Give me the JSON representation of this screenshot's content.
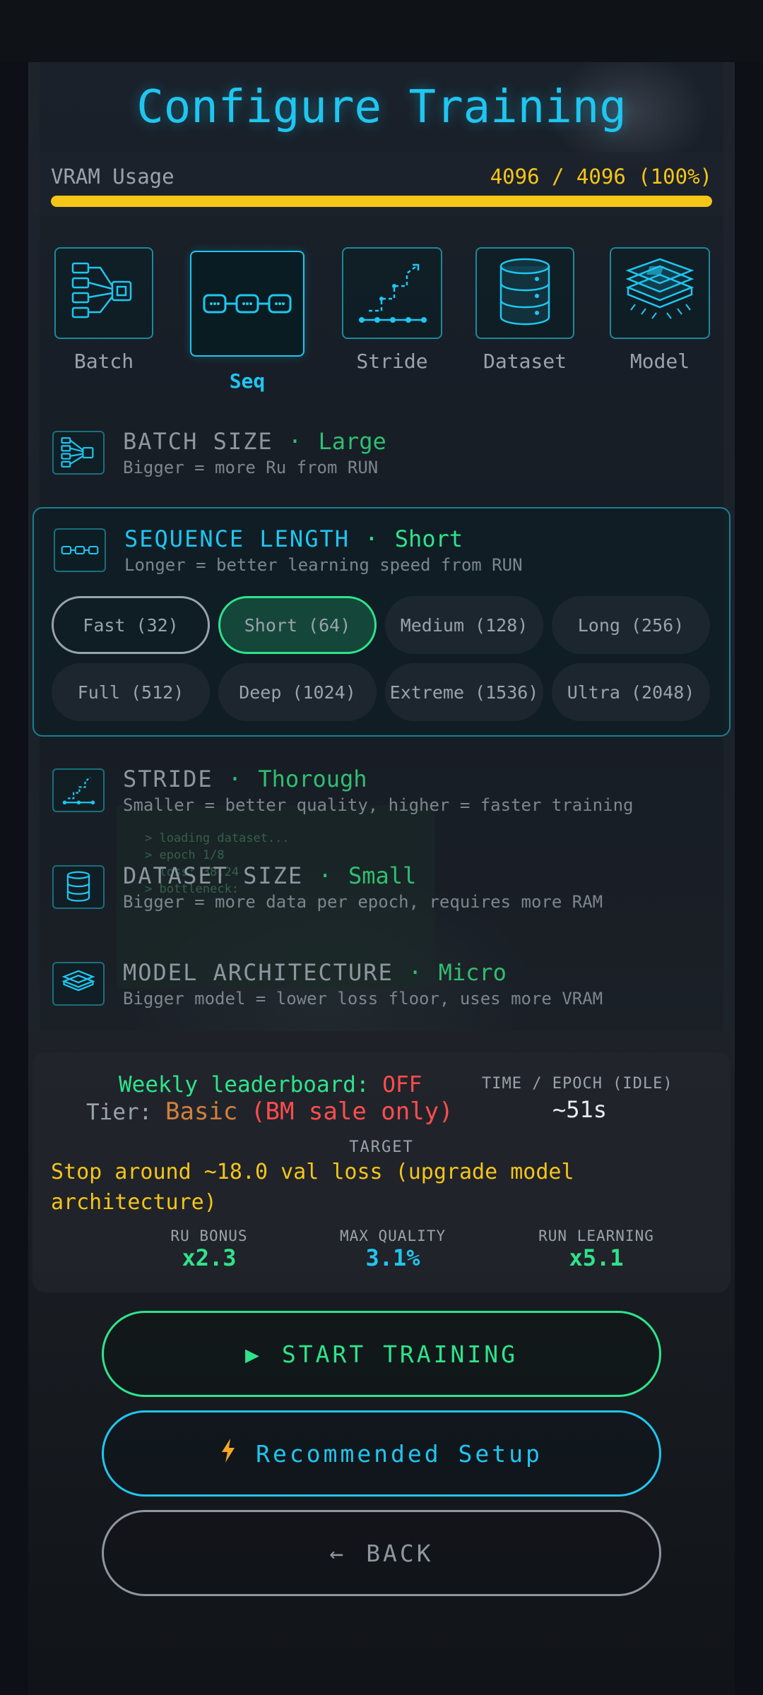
{
  "title": "Configure Training",
  "vram": {
    "label": "VRAM Usage",
    "value": "4096 / 4096 (100%)",
    "fill_fraction": 1.0,
    "color": "#f5c518"
  },
  "tiles": [
    {
      "label": "Batch",
      "icon": "batch-network-icon"
    },
    {
      "label": "Seq",
      "icon": "chain-links-icon",
      "active": true
    },
    {
      "label": "Stride",
      "icon": "stride-steps-icon"
    },
    {
      "label": "Dataset",
      "icon": "database-icon"
    },
    {
      "label": "Model",
      "icon": "layered-chip-icon"
    }
  ],
  "sections": {
    "batch": {
      "title": "BATCH SIZE",
      "sep": "·",
      "value": "Large",
      "subtitle": "Bigger = more Ru from RUN"
    },
    "seq": {
      "title": "SEQUENCE LENGTH",
      "sep": "·",
      "value": "Short",
      "subtitle": "Longer = better learning speed from RUN"
    },
    "stride": {
      "title": "STRIDE",
      "sep": "·",
      "value": "Thorough",
      "subtitle": "Smaller = better quality, higher = faster training"
    },
    "dataset": {
      "title": "DATASET SIZE",
      "sep": "·",
      "value": "Small",
      "subtitle": "Bigger = more data per epoch, requires more RAM"
    },
    "model": {
      "title": "MODEL ARCHITECTURE",
      "sep": "·",
      "value": "Micro",
      "subtitle": "Bigger model = lower loss floor, uses more VRAM"
    }
  },
  "seq_options": [
    "Fast (32)",
    "Short (64)",
    "Medium (128)",
    "Long (256)",
    "Full (512)",
    "Deep (1024)",
    "Extreme (1536)",
    "Ultra (2048)"
  ],
  "seq_selected": "Short (64)",
  "stats": {
    "leaderboard_label": "Weekly leaderboard:",
    "leaderboard_value": "OFF",
    "tier_label": "Tier:",
    "tier_value": "Basic",
    "tier_note": "(BM sale only)",
    "time_epoch_label": "TIME / EPOCH (IDLE)",
    "time_epoch_value": "~51s",
    "target_label": "TARGET",
    "target_text": "Stop around ~18.0 val loss (upgrade model architecture)",
    "ru_bonus_label": "RU BONUS",
    "ru_bonus_value": "x2.3",
    "max_quality_label": "MAX QUALITY",
    "max_quality_value": "3.1%",
    "run_learning_label": "RUN LEARNING",
    "run_learning_value": "x5.1"
  },
  "buttons": {
    "start": "START TRAINING",
    "recommended": "Recommended Setup",
    "back": "BACK"
  },
  "background_terminal": "> loading dataset...\n> epoch 1/8\n  loss: 38.24\n> bottleneck:",
  "colors": {
    "accent_cyan": "#1fc6f0",
    "accent_green": "#2fe38c",
    "warning_yellow": "#f5c518",
    "alert_red": "#ff4d4d"
  }
}
